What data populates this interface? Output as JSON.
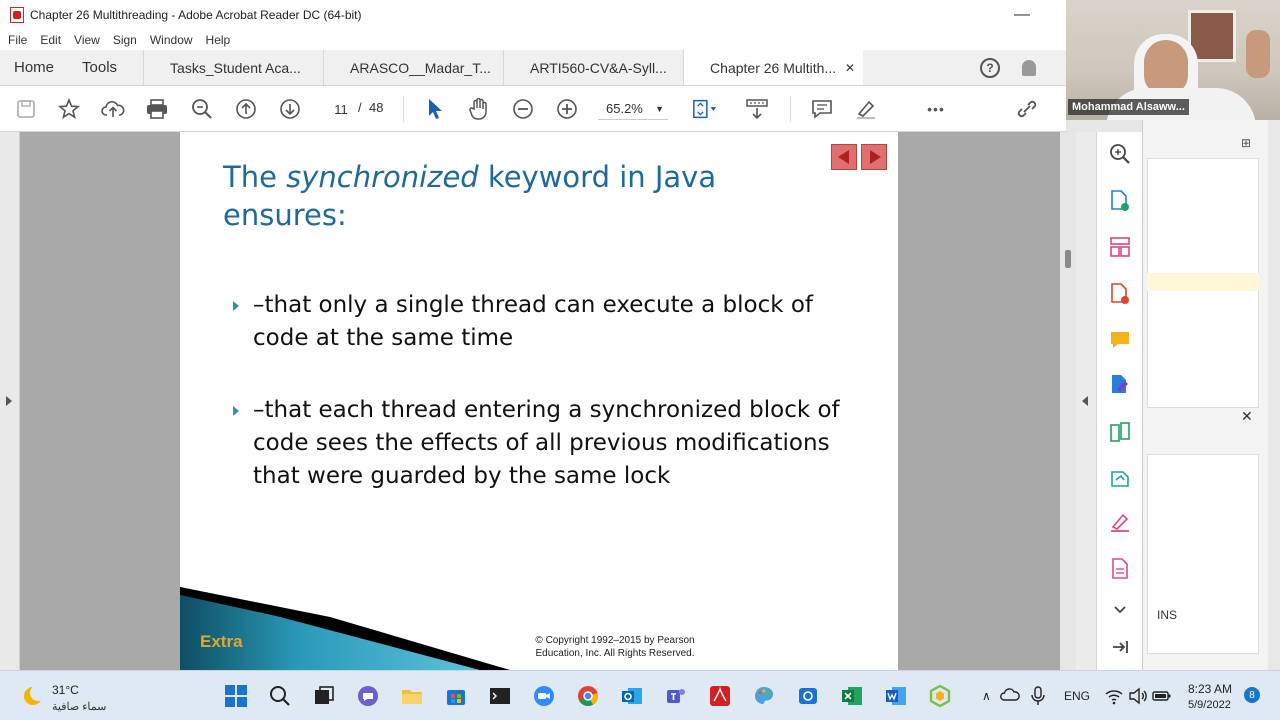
{
  "window": {
    "title": "Chapter 26 Multithreading - Adobe Acrobat Reader DC (64-bit)",
    "minimize": "—"
  },
  "menu": [
    "File",
    "Edit",
    "View",
    "Sign",
    "Window",
    "Help"
  ],
  "tabs": {
    "home": "Home",
    "tools": "Tools",
    "docs": [
      "Tasks_Student Aca...",
      "ARASCO__Madar_T...",
      "ARTI560-CV&A-Syll...",
      "Chapter 26 Multith..."
    ],
    "close": "✕",
    "help": "?"
  },
  "toolbar": {
    "page_current": "11",
    "page_sep": "/",
    "page_total": "48",
    "zoom": "65.2%",
    "more": "•••"
  },
  "slide": {
    "title_part1": "The ",
    "title_em": "synchronized",
    "title_part2": "  keyword in Java ensures:",
    "bullets": [
      "–that only a single thread can execute a block of code at the same time",
      "–that each thread entering a synchronized block of code sees the effects of all previous modifications that were guarded by the same lock"
    ],
    "footer_label": "Extra",
    "copyright": "© Copyright 1992–2015 by Pearson Education, Inc. All Rights Reserved."
  },
  "side_window": {
    "close": "✕",
    "ins": "INS"
  },
  "webcam": {
    "name": "Mohammad Alsaww..."
  },
  "taskbar": {
    "temp": "31°C",
    "condition": "سماء صافية",
    "lang": "ENG",
    "time": "8:23 AM",
    "date": "5/9/2022",
    "notifications": "8"
  },
  "colors": {
    "accent": "#1f6a9a",
    "bullet": "#2e8fb8",
    "acrobat_red": "#d32020"
  }
}
